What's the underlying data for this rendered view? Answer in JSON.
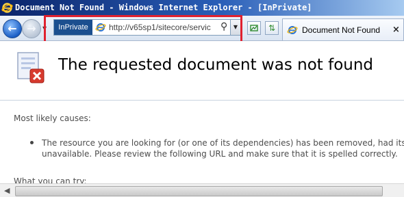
{
  "window": {
    "title": "Document Not Found - Windows Internet Explorer - [InPrivate]"
  },
  "toolbar": {
    "inprivate_label": "InPrivate",
    "address_url": "http://v65sp1/sitecore/servic",
    "tab_label": "Document Not Found",
    "tab_close": "×"
  },
  "page": {
    "heading": "The requested document was not found",
    "causes_label": "Most likely causes:",
    "cause_line_1": "The resource you are looking for (or one of its dependencies) has been removed, had its nar",
    "cause_line_2": "unavailable. Please review the following URL and make sure that it is spelled correctly.",
    "next_label": "What you can try:"
  },
  "colors": {
    "highlight": "#e0212f",
    "titlebar": "#0b246a",
    "inprivate_badge": "#1b4f8f"
  },
  "icons": [
    "ie-logo-icon",
    "back-arrow-icon",
    "forward-arrow-icon",
    "page-icon",
    "search-icon",
    "compatibility-view-icon",
    "refresh-icon",
    "error-document-icon"
  ]
}
